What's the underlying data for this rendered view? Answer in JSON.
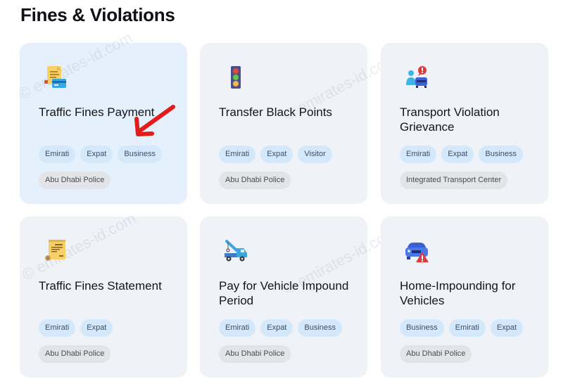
{
  "page": {
    "title": "Fines & Violations",
    "watermark": "© emirates-id.com"
  },
  "colors": {
    "card_bg": "#eff2f6",
    "card_active_bg": "#e4f0fc",
    "audience_tag_bg": "#d3e9fb",
    "entity_tag_bg": "#e2e4e8",
    "annotation_arrow": "#e31b1b"
  },
  "cards": [
    {
      "title": "Traffic Fines Payment",
      "icon": "bill-with-card-icon",
      "audience_tags": [
        "Emirati",
        "Expat",
        "Business"
      ],
      "entity": "Abu Dhabi Police",
      "highlighted": true
    },
    {
      "title": "Transfer Black Points",
      "icon": "traffic-light-icon",
      "audience_tags": [
        "Emirati",
        "Expat",
        "Visitor"
      ],
      "entity": "Abu Dhabi Police"
    },
    {
      "title": "Transport Violation Grievance",
      "icon": "person-car-alert-icon",
      "audience_tags": [
        "Emirati",
        "Expat",
        "Business"
      ],
      "entity": "Integrated Transport Center"
    },
    {
      "title": "Traffic Fines Statement",
      "icon": "statement-document-icon",
      "audience_tags": [
        "Emirati",
        "Expat"
      ],
      "entity": "Abu Dhabi Police"
    },
    {
      "title": "Pay for Vehicle Impound Period",
      "icon": "tow-truck-icon",
      "audience_tags": [
        "Emirati",
        "Expat",
        "Business"
      ],
      "entity": "Abu Dhabi Police"
    },
    {
      "title": "Home-Impounding for Vehicles",
      "icon": "car-warning-icon",
      "audience_tags": [
        "Business",
        "Emirati",
        "Expat"
      ],
      "entity": "Abu Dhabi Police"
    }
  ]
}
